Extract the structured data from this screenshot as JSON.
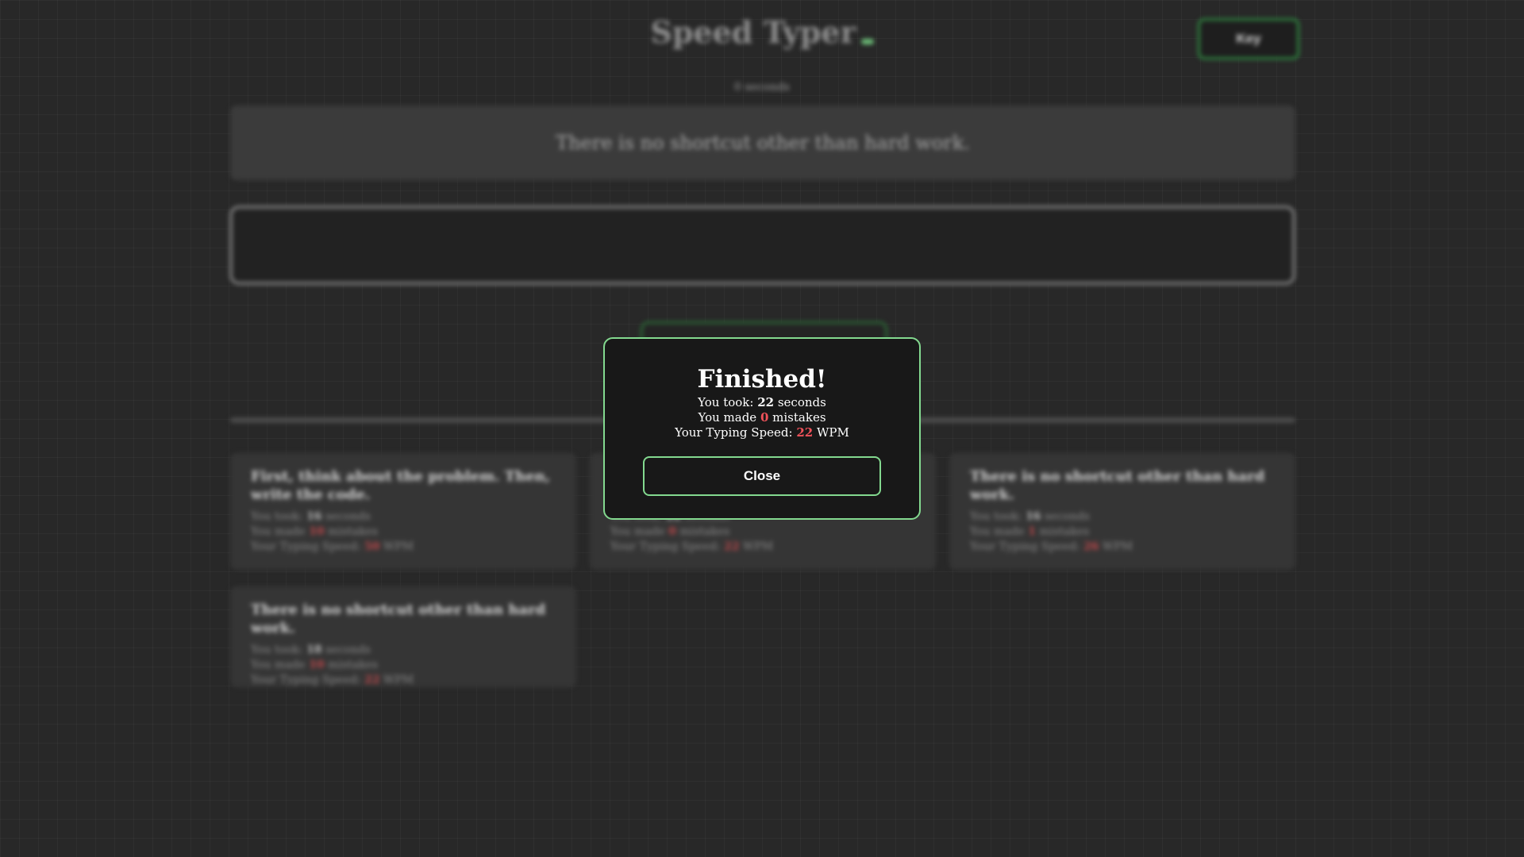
{
  "background_app": {
    "title": "Speed Typer",
    "key_button_label": "Key",
    "timer_text": "0 seconds",
    "prompt_quote": "There is no shortcut other than hard work.",
    "history": [
      {
        "quote": "First, think about the problem. Then, write the code.",
        "seconds": "16",
        "mistakes": "10",
        "wpm": "50"
      },
      {
        "quote": "",
        "seconds": "22",
        "mistakes": "0",
        "wpm": "22"
      },
      {
        "quote": "There is no shortcut other than hard work.",
        "seconds": "16",
        "mistakes": "1",
        "wpm": "26"
      },
      {
        "quote": "There is no shortcut other than hard work.",
        "seconds": "18",
        "mistakes": "10",
        "wpm": "22"
      }
    ],
    "history_labels": {
      "took_prefix": "You took: ",
      "took_suffix": " seconds",
      "mistakes_prefix": "You made ",
      "mistakes_suffix": " mistakes",
      "speed_prefix": "Your Typing Speed: ",
      "speed_suffix": " WPM"
    }
  },
  "modal": {
    "title": "Finished!",
    "took_prefix": "You took: ",
    "took_value": "22",
    "took_suffix": " seconds",
    "mistakes_prefix": "You made ",
    "mistakes_value": "0",
    "mistakes_suffix": " mistakes",
    "speed_prefix": "Your Typing Speed: ",
    "speed_value": "22",
    "speed_suffix": " WPM",
    "close_label": "Close"
  },
  "colors": {
    "accent_green": "#83d98f",
    "stat_red": "#f0525a",
    "modal_background": "#181818",
    "page_background": "#282828"
  }
}
